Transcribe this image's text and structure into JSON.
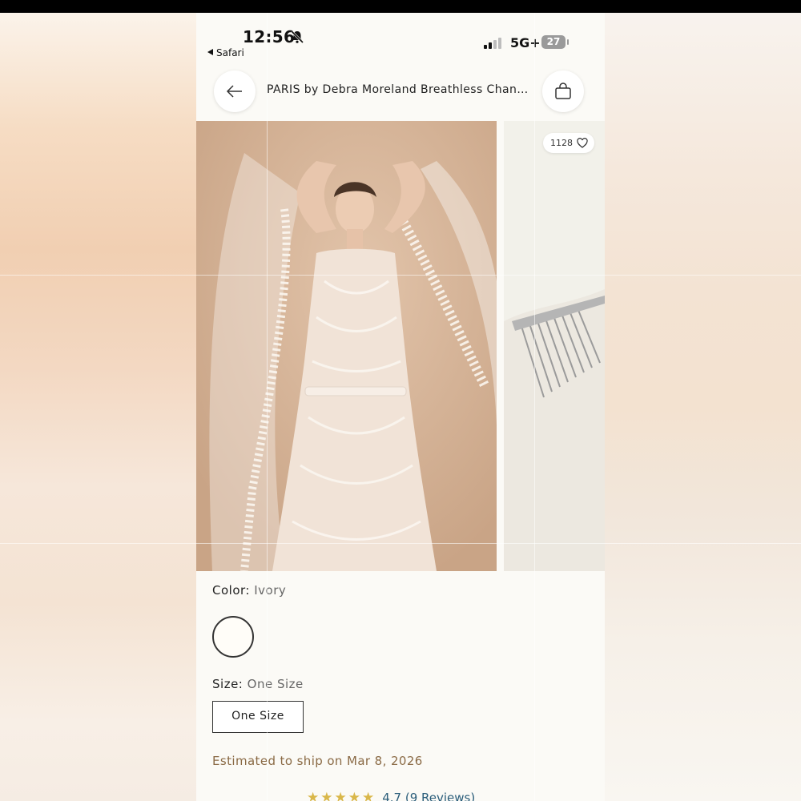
{
  "status_bar": {
    "time": "12:56",
    "back_app": "Safari",
    "network": "5G+",
    "battery": "27"
  },
  "header": {
    "title": "PARIS by Debra Moreland Breathless Chantil..."
  },
  "gallery": {
    "like_count": "1128"
  },
  "product": {
    "color_label": "Color:",
    "color_value": "Ivory",
    "size_label": "Size:",
    "size_value": "One Size",
    "size_option": "One Size",
    "ship_text": "Estimated to ship on Mar 8, 2026",
    "rating_value": "4.7",
    "reviews_text": "(9 Reviews)",
    "rating_fraction": 0.94
  },
  "colors": {
    "accent_brown": "#8a6a45",
    "link_blue": "#2a5d7a",
    "star_gold": "#d9b74a",
    "swatch_ivory": "#fffdf8"
  },
  "icons": [
    "bell-slash-icon",
    "back-arrow-icon",
    "shopping-bag-icon",
    "heart-icon",
    "star-icon"
  ]
}
